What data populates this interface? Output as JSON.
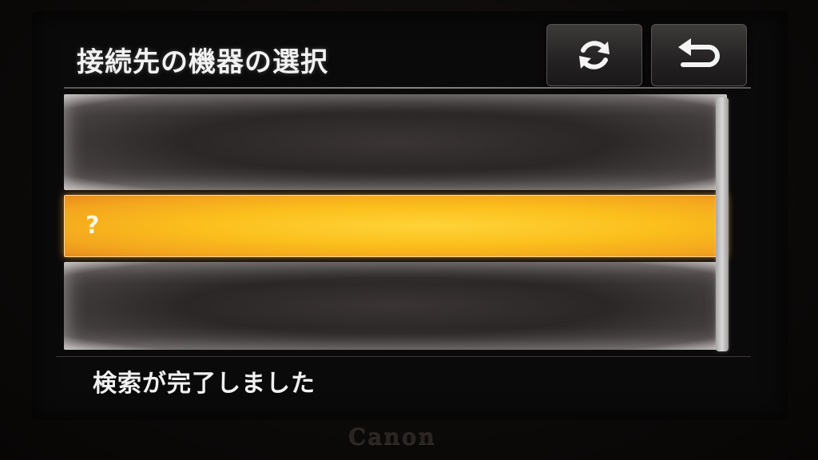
{
  "screen": {
    "title": "接続先の機器の選択"
  },
  "header_buttons": {
    "refresh_icon": "refresh-icon",
    "back_icon": "back-icon"
  },
  "device_list": {
    "rows": [
      {
        "label": ""
      },
      {
        "label": "?",
        "selected": true
      },
      {
        "label": ""
      }
    ]
  },
  "status": {
    "message": "検索が完了しました"
  },
  "brand": {
    "logo": "Canon"
  },
  "colors": {
    "selection": "#f7b521",
    "background": "#0b0a0a",
    "text": "#f0f0f0"
  }
}
